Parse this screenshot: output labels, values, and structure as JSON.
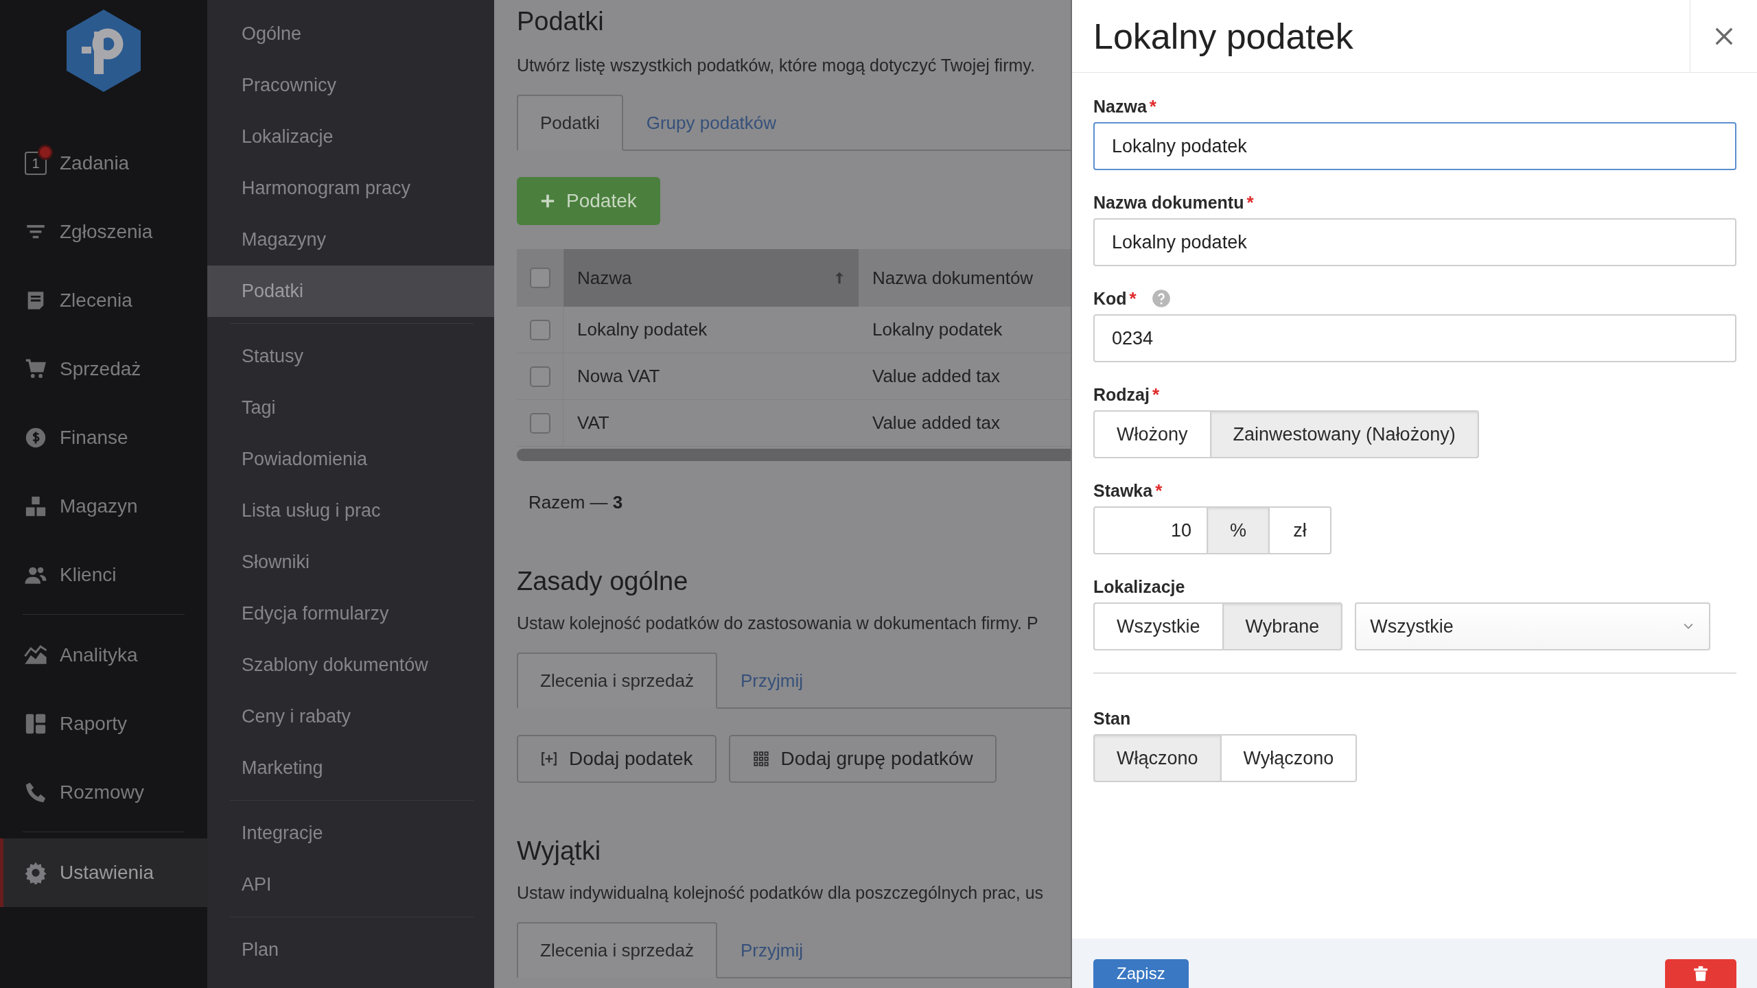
{
  "sidebar": {
    "groups": [
      [
        {
          "label": "Zadania",
          "selected": false,
          "badge": "1",
          "notification": true
        },
        {
          "label": "Zgłoszenia",
          "selected": false
        },
        {
          "label": "Zlecenia",
          "selected": false
        },
        {
          "label": "Sprzedaż",
          "selected": false
        },
        {
          "label": "Finanse",
          "selected": false
        },
        {
          "label": "Magazyn",
          "selected": false
        },
        {
          "label": "Klienci",
          "selected": false
        }
      ],
      [
        {
          "label": "Analityka",
          "selected": false
        },
        {
          "label": "Raporty",
          "selected": false
        },
        {
          "label": "Rozmowy",
          "selected": false
        }
      ],
      [
        {
          "label": "Ustawienia",
          "selected": true
        }
      ]
    ]
  },
  "settings_menu": {
    "groups": [
      [
        {
          "label": "Ogólne",
          "selected": false
        },
        {
          "label": "Pracownicy",
          "selected": false
        },
        {
          "label": "Lokalizacje",
          "selected": false
        },
        {
          "label": "Harmonogram pracy",
          "selected": false
        },
        {
          "label": "Magazyny",
          "selected": false
        },
        {
          "label": "Podatki",
          "selected": true
        }
      ],
      [
        {
          "label": "Statusy",
          "selected": false
        },
        {
          "label": "Tagi",
          "selected": false
        },
        {
          "label": "Powiadomienia",
          "selected": false
        },
        {
          "label": "Lista usług i prac",
          "selected": false
        },
        {
          "label": "Słowniki",
          "selected": false
        },
        {
          "label": "Edycja formularzy",
          "selected": false
        },
        {
          "label": "Szablony dokumentów",
          "selected": false
        },
        {
          "label": "Ceny i rabaty",
          "selected": false
        },
        {
          "label": "Marketing",
          "selected": false
        }
      ],
      [
        {
          "label": "Integracje",
          "selected": false
        },
        {
          "label": "API",
          "selected": false
        }
      ],
      [
        {
          "label": "Plan",
          "selected": false
        }
      ]
    ]
  },
  "content": {
    "title": "Podatki",
    "description": "Utwórz listę wszystkich podatków, które mogą dotyczyć Twojej firmy.",
    "tabs": [
      {
        "label": "Podatki",
        "selected": true
      },
      {
        "label": "Grupy podatków",
        "selected": false
      }
    ],
    "add_button": "Podatek",
    "table": {
      "all_checked": false,
      "columns": [
        {
          "label": "Nazwa",
          "sorted": true
        },
        {
          "label": "Nazwa dokumentów",
          "sorted": false
        }
      ],
      "rows": [
        {
          "checked": false,
          "cells": [
            "Lokalny podatek",
            "Lokalny podatek"
          ]
        },
        {
          "checked": false,
          "cells": [
            "Nowa VAT",
            "Value added tax"
          ]
        },
        {
          "checked": false,
          "cells": [
            "VAT",
            "Value added tax"
          ]
        }
      ]
    },
    "total": "Razem — **3**",
    "sections": [
      {
        "title": "Zasady ogólne",
        "description": "Ustaw kolejność podatków do zastosowania w dokumentach firmy. P",
        "tabs": [
          {
            "label": "Zlecenia i sprzedaż",
            "selected": true
          },
          {
            "label": "Przyjmij",
            "selected": false
          }
        ],
        "buttons": [
          "Dodaj podatek",
          "Dodaj grupę podatków"
        ]
      },
      {
        "title": "Wyjątki",
        "description": "Ustaw indywidualną kolejność podatków dla poszczególnych prac, us",
        "tabs": [
          {
            "label": "Zlecenia i sprzedaż",
            "selected": true
          },
          {
            "label": "Przyjmij",
            "selected": false
          }
        ]
      }
    ]
  },
  "panel": {
    "title": "Lokalny podatek",
    "sections": [
      [
        {
          "kind": "text",
          "label": "Nazwa",
          "required_mark": "*",
          "value": "Lokalny podatek",
          "focused": true
        },
        {
          "kind": "text",
          "label": "Nazwa dokumentu",
          "required_mark": "*",
          "value": "Lokalny podatek",
          "focused": false
        },
        {
          "kind": "text",
          "label": "Kod",
          "required_mark": "*",
          "help": true,
          "value": "0234",
          "focused": false
        },
        {
          "kind": "segmented",
          "label": "Rodzaj",
          "required_mark": "*",
          "options": [
            {
              "label": "Włożony",
              "selected": false
            },
            {
              "label": "Zainwestowany (Nałożony)",
              "selected": true
            }
          ]
        },
        {
          "kind": "rate",
          "label": "Stawka",
          "required_mark": "*",
          "value": "10",
          "units": [
            {
              "label": "%",
              "selected": true
            },
            {
              "label": "zł",
              "selected": false
            }
          ]
        },
        {
          "kind": "segmented",
          "label": "Lokalizacje",
          "options": [
            {
              "label": "Wszystkie",
              "selected": false
            },
            {
              "label": "Wybrane",
              "selected": true
            }
          ],
          "select": "Wszystkie"
        }
      ],
      [
        {
          "kind": "segmented",
          "label": "Stan",
          "options": [
            {
              "label": "Włączono",
              "selected": true
            },
            {
              "label": "Wyłączono",
              "selected": false
            }
          ]
        }
      ]
    ],
    "save_button": "Zapisz"
  }
}
